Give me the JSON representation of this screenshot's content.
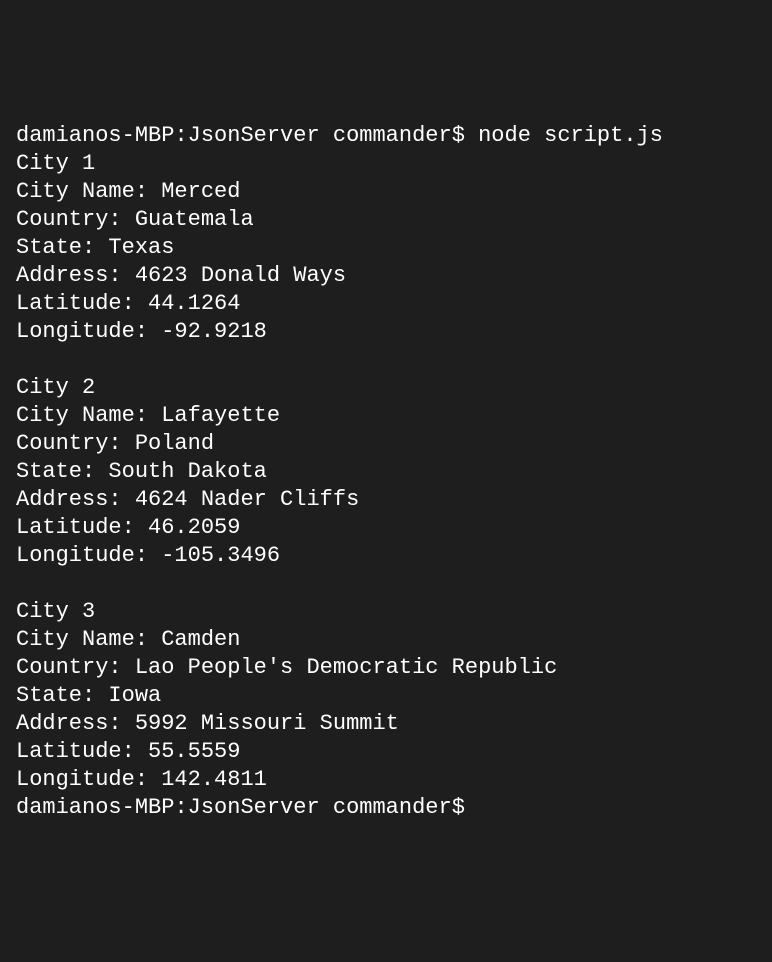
{
  "prompt": {
    "host": "damianos-MBP",
    "cwd": "JsonServer",
    "user": "commander",
    "separator1": ":",
    "separator2": "$"
  },
  "command": "node script.js",
  "labels": {
    "cityHeaderPrefix": "City",
    "cityName": "City Name:",
    "country": "Country:",
    "state": "State:",
    "address": "Address:",
    "latitude": "Latitude:",
    "longitude": "Longitude:"
  },
  "cities": [
    {
      "index": "1",
      "name": "Merced",
      "country": "Guatemala",
      "state": "Texas",
      "address": "4623 Donald Ways",
      "latitude": "44.1264",
      "longitude": "-92.9218"
    },
    {
      "index": "2",
      "name": "Lafayette",
      "country": "Poland",
      "state": "South Dakota",
      "address": "4624 Nader Cliffs",
      "latitude": "46.2059",
      "longitude": "-105.3496"
    },
    {
      "index": "3",
      "name": "Camden",
      "country": "Lao People's Democratic Republic",
      "state": "Iowa",
      "address": "5992 Missouri Summit",
      "latitude": "55.5559",
      "longitude": "142.4811"
    }
  ]
}
